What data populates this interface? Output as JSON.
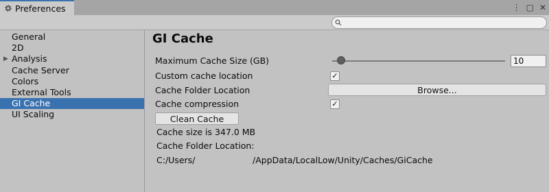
{
  "window": {
    "tab_title": "Preferences",
    "controls": {
      "menu": "⋮",
      "maximize": "▢",
      "close": "✕"
    }
  },
  "search": {
    "placeholder": "",
    "value": ""
  },
  "sidebar": {
    "items": [
      {
        "label": "General"
      },
      {
        "label": "2D"
      },
      {
        "label": "Analysis",
        "expandable": true
      },
      {
        "label": "Cache Server"
      },
      {
        "label": "Colors"
      },
      {
        "label": "External Tools"
      },
      {
        "label": "GI Cache",
        "selected": true
      },
      {
        "label": "UI Scaling"
      }
    ]
  },
  "main": {
    "title": "GI Cache",
    "max_cache_label": "Maximum Cache Size (GB)",
    "max_cache_value": "10",
    "max_cache_slider_fraction": 0.05,
    "custom_location_label": "Custom cache location",
    "custom_location_checked": "✓",
    "folder_location_label": "Cache Folder Location",
    "browse_label": "Browse...",
    "compression_label": "Cache compression",
    "compression_checked": "✓",
    "clean_cache_label": "Clean Cache",
    "cache_size_text": "Cache size is 347.0 MB",
    "folder_location_heading": "Cache Folder Location:",
    "path_prefix": "C:/Users/",
    "path_suffix": "/AppData/LocalLow/Unity/Caches/GiCache"
  },
  "colors": {
    "accent": "#3a72b0",
    "panel": "#c2c2c2"
  }
}
